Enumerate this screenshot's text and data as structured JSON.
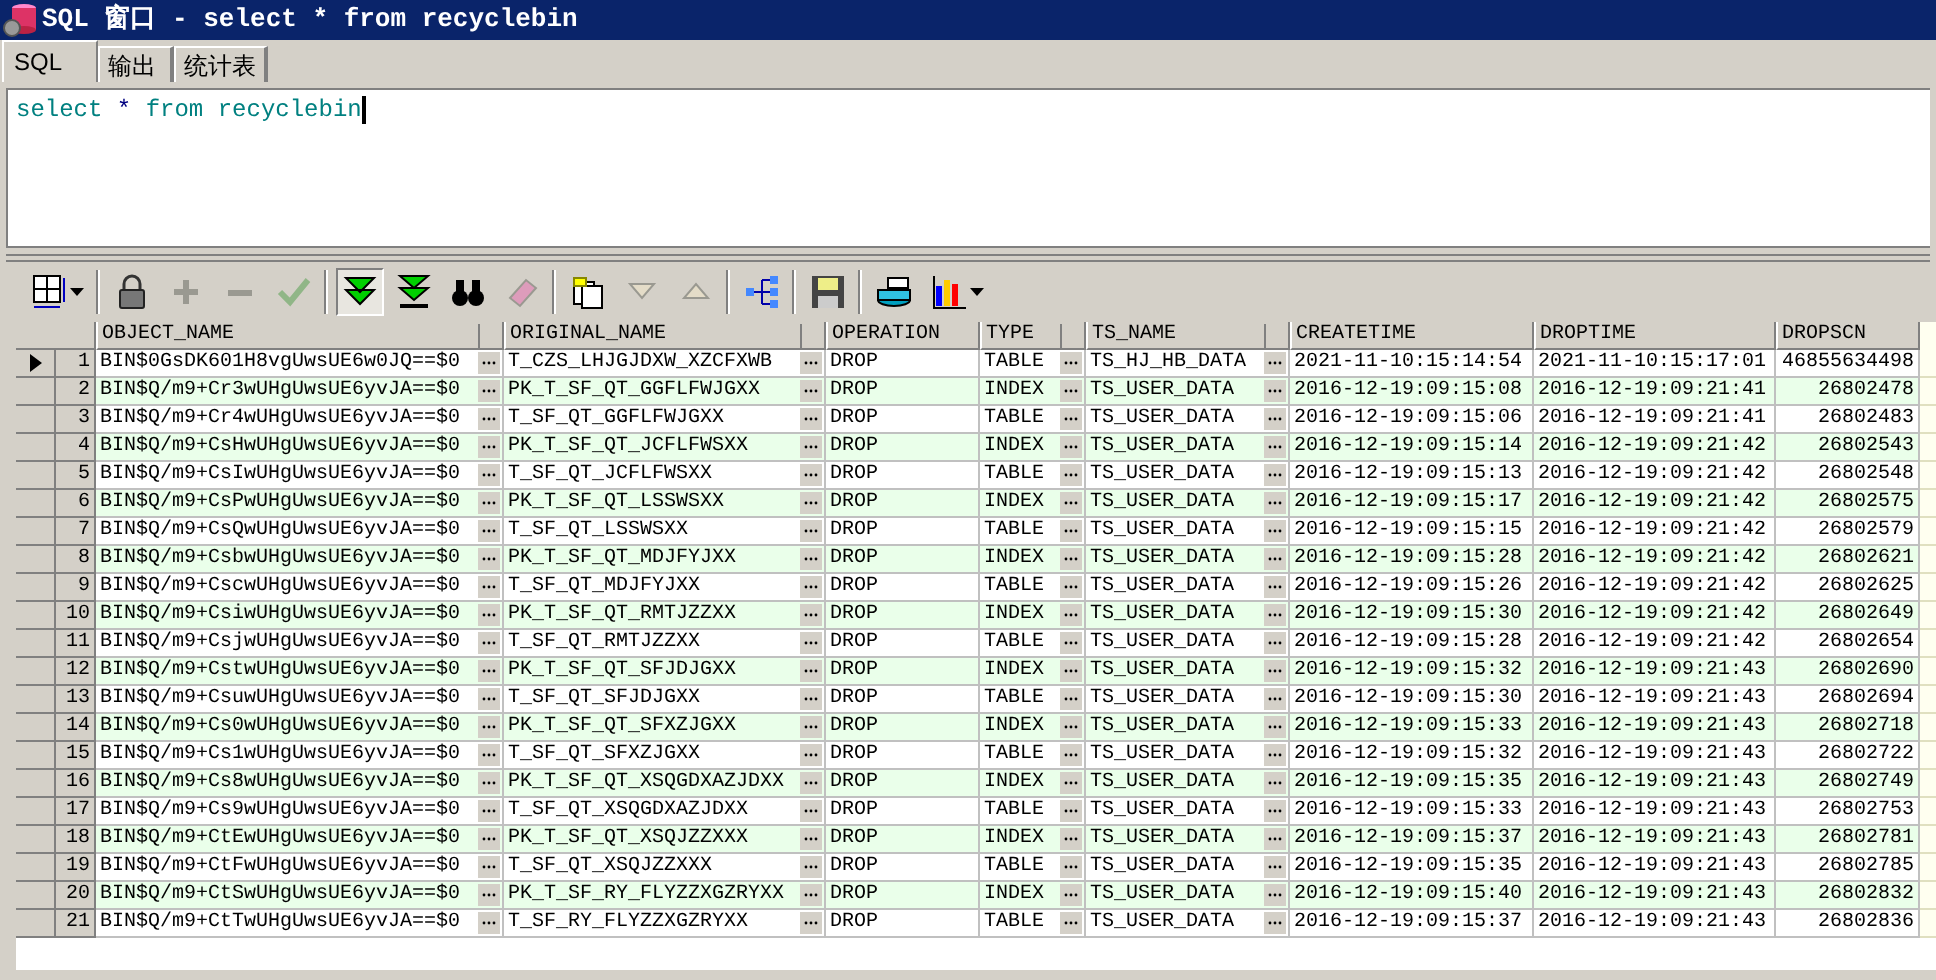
{
  "window": {
    "title": "SQL 窗口 - select * from recyclebin"
  },
  "tabs": [
    {
      "label": "SQL",
      "selected": true
    },
    {
      "label": "输出",
      "selected": false
    },
    {
      "label": "统计表",
      "selected": false
    }
  ],
  "editor": {
    "tokens": [
      {
        "text": "select",
        "kind": "keyword"
      },
      {
        "text": "*",
        "kind": "operator"
      },
      {
        "text": "from",
        "kind": "keyword"
      },
      {
        "text": "recyclebin",
        "kind": "identifier"
      }
    ]
  },
  "toolbar": [
    {
      "kind": "grid",
      "disabled": false,
      "pressed": false,
      "dropdown": true
    },
    {
      "kind": "lock",
      "disabled": false,
      "pressed": false,
      "dropdown": false
    },
    {
      "kind": "plus",
      "disabled": true,
      "pressed": false,
      "dropdown": false
    },
    {
      "kind": "minus",
      "disabled": true,
      "pressed": false,
      "dropdown": false
    },
    {
      "kind": "check",
      "disabled": true,
      "pressed": false,
      "dropdown": false
    },
    {
      "kind": "fetch-next",
      "disabled": false,
      "pressed": true,
      "dropdown": false
    },
    {
      "kind": "fetch-last",
      "disabled": false,
      "pressed": false,
      "dropdown": false
    },
    {
      "kind": "find",
      "disabled": false,
      "pressed": false,
      "dropdown": false
    },
    {
      "kind": "clear",
      "disabled": true,
      "pressed": false,
      "dropdown": false
    },
    {
      "kind": "note",
      "disabled": false,
      "pressed": false,
      "dropdown": false
    },
    {
      "kind": "down",
      "disabled": true,
      "pressed": false,
      "dropdown": false
    },
    {
      "kind": "up",
      "disabled": true,
      "pressed": false,
      "dropdown": false
    },
    {
      "kind": "tree",
      "disabled": false,
      "pressed": false,
      "dropdown": false
    },
    {
      "kind": "save",
      "disabled": false,
      "pressed": false,
      "dropdown": false
    },
    {
      "kind": "print",
      "disabled": false,
      "pressed": false,
      "dropdown": false
    },
    {
      "kind": "chart",
      "disabled": false,
      "pressed": false,
      "dropdown": true
    }
  ],
  "table": {
    "columns": [
      {
        "label": "OBJECT_NAME",
        "ellipsis": true,
        "kind": "text"
      },
      {
        "label": "ORIGINAL_NAME",
        "ellipsis": true,
        "kind": "text"
      },
      {
        "label": "OPERATION",
        "ellipsis": false,
        "kind": "text"
      },
      {
        "label": "TYPE",
        "ellipsis": true,
        "kind": "text"
      },
      {
        "label": "TS_NAME",
        "ellipsis": true,
        "kind": "text"
      },
      {
        "label": "CREATETIME",
        "ellipsis": false,
        "kind": "text"
      },
      {
        "label": "DROPTIME",
        "ellipsis": false,
        "kind": "text"
      },
      {
        "label": "DROPSCN",
        "ellipsis": false,
        "kind": "number"
      }
    ],
    "rows": [
      {
        "number": "1",
        "current": true,
        "cells": [
          "BIN$0GsDK601H8vgUwsUE6w0JQ==$0",
          "T_CZS_LHJGJDXW_XZCFXWB",
          "DROP",
          "TABLE",
          "TS_HJ_HB_DATA",
          "2021-11-10:15:14:54",
          "2021-11-10:15:17:01",
          "46855634498"
        ]
      },
      {
        "number": "2",
        "current": false,
        "cells": [
          "BIN$Q/m9+Cr3wUHgUwsUE6yvJA==$0",
          "PK_T_SF_QT_GGFLFWJGXX",
          "DROP",
          "INDEX",
          "TS_USER_DATA",
          "2016-12-19:09:15:08",
          "2016-12-19:09:21:41",
          "26802478"
        ]
      },
      {
        "number": "3",
        "current": false,
        "cells": [
          "BIN$Q/m9+Cr4wUHgUwsUE6yvJA==$0",
          "T_SF_QT_GGFLFWJGXX",
          "DROP",
          "TABLE",
          "TS_USER_DATA",
          "2016-12-19:09:15:06",
          "2016-12-19:09:21:41",
          "26802483"
        ]
      },
      {
        "number": "4",
        "current": false,
        "cells": [
          "BIN$Q/m9+CsHwUHgUwsUE6yvJA==$0",
          "PK_T_SF_QT_JCFLFWSXX",
          "DROP",
          "INDEX",
          "TS_USER_DATA",
          "2016-12-19:09:15:14",
          "2016-12-19:09:21:42",
          "26802543"
        ]
      },
      {
        "number": "5",
        "current": false,
        "cells": [
          "BIN$Q/m9+CsIwUHgUwsUE6yvJA==$0",
          "T_SF_QT_JCFLFWSXX",
          "DROP",
          "TABLE",
          "TS_USER_DATA",
          "2016-12-19:09:15:13",
          "2016-12-19:09:21:42",
          "26802548"
        ]
      },
      {
        "number": "6",
        "current": false,
        "cells": [
          "BIN$Q/m9+CsPwUHgUwsUE6yvJA==$0",
          "PK_T_SF_QT_LSSWSXX",
          "DROP",
          "INDEX",
          "TS_USER_DATA",
          "2016-12-19:09:15:17",
          "2016-12-19:09:21:42",
          "26802575"
        ]
      },
      {
        "number": "7",
        "current": false,
        "cells": [
          "BIN$Q/m9+CsQwUHgUwsUE6yvJA==$0",
          "T_SF_QT_LSSWSXX",
          "DROP",
          "TABLE",
          "TS_USER_DATA",
          "2016-12-19:09:15:15",
          "2016-12-19:09:21:42",
          "26802579"
        ]
      },
      {
        "number": "8",
        "current": false,
        "cells": [
          "BIN$Q/m9+CsbwUHgUwsUE6yvJA==$0",
          "PK_T_SF_QT_MDJFYJXX",
          "DROP",
          "INDEX",
          "TS_USER_DATA",
          "2016-12-19:09:15:28",
          "2016-12-19:09:21:42",
          "26802621"
        ]
      },
      {
        "number": "9",
        "current": false,
        "cells": [
          "BIN$Q/m9+CscwUHgUwsUE6yvJA==$0",
          "T_SF_QT_MDJFYJXX",
          "DROP",
          "TABLE",
          "TS_USER_DATA",
          "2016-12-19:09:15:26",
          "2016-12-19:09:21:42",
          "26802625"
        ]
      },
      {
        "number": "10",
        "current": false,
        "cells": [
          "BIN$Q/m9+CsiwUHgUwsUE6yvJA==$0",
          "PK_T_SF_QT_RMTJZZXX",
          "DROP",
          "INDEX",
          "TS_USER_DATA",
          "2016-12-19:09:15:30",
          "2016-12-19:09:21:42",
          "26802649"
        ]
      },
      {
        "number": "11",
        "current": false,
        "cells": [
          "BIN$Q/m9+CsjwUHgUwsUE6yvJA==$0",
          "T_SF_QT_RMTJZZXX",
          "DROP",
          "TABLE",
          "TS_USER_DATA",
          "2016-12-19:09:15:28",
          "2016-12-19:09:21:42",
          "26802654"
        ]
      },
      {
        "number": "12",
        "current": false,
        "cells": [
          "BIN$Q/m9+CstwUHgUwsUE6yvJA==$0",
          "PK_T_SF_QT_SFJDJGXX",
          "DROP",
          "INDEX",
          "TS_USER_DATA",
          "2016-12-19:09:15:32",
          "2016-12-19:09:21:43",
          "26802690"
        ]
      },
      {
        "number": "13",
        "current": false,
        "cells": [
          "BIN$Q/m9+CsuwUHgUwsUE6yvJA==$0",
          "T_SF_QT_SFJDJGXX",
          "DROP",
          "TABLE",
          "TS_USER_DATA",
          "2016-12-19:09:15:30",
          "2016-12-19:09:21:43",
          "26802694"
        ]
      },
      {
        "number": "14",
        "current": false,
        "cells": [
          "BIN$Q/m9+Cs0wUHgUwsUE6yvJA==$0",
          "PK_T_SF_QT_SFXZJGXX",
          "DROP",
          "INDEX",
          "TS_USER_DATA",
          "2016-12-19:09:15:33",
          "2016-12-19:09:21:43",
          "26802718"
        ]
      },
      {
        "number": "15",
        "current": false,
        "cells": [
          "BIN$Q/m9+Cs1wUHgUwsUE6yvJA==$0",
          "T_SF_QT_SFXZJGXX",
          "DROP",
          "TABLE",
          "TS_USER_DATA",
          "2016-12-19:09:15:32",
          "2016-12-19:09:21:43",
          "26802722"
        ]
      },
      {
        "number": "16",
        "current": false,
        "cells": [
          "BIN$Q/m9+Cs8wUHgUwsUE6yvJA==$0",
          "PK_T_SF_QT_XSQGDXAZJDXX",
          "DROP",
          "INDEX",
          "TS_USER_DATA",
          "2016-12-19:09:15:35",
          "2016-12-19:09:21:43",
          "26802749"
        ]
      },
      {
        "number": "17",
        "current": false,
        "cells": [
          "BIN$Q/m9+Cs9wUHgUwsUE6yvJA==$0",
          "T_SF_QT_XSQGDXAZJDXX",
          "DROP",
          "TABLE",
          "TS_USER_DATA",
          "2016-12-19:09:15:33",
          "2016-12-19:09:21:43",
          "26802753"
        ]
      },
      {
        "number": "18",
        "current": false,
        "cells": [
          "BIN$Q/m9+CtEwUHgUwsUE6yvJA==$0",
          "PK_T_SF_QT_XSQJZZXXX",
          "DROP",
          "INDEX",
          "TS_USER_DATA",
          "2016-12-19:09:15:37",
          "2016-12-19:09:21:43",
          "26802781"
        ]
      },
      {
        "number": "19",
        "current": false,
        "cells": [
          "BIN$Q/m9+CtFwUHgUwsUE6yvJA==$0",
          "T_SF_QT_XSQJZZXXX",
          "DROP",
          "TABLE",
          "TS_USER_DATA",
          "2016-12-19:09:15:35",
          "2016-12-19:09:21:43",
          "26802785"
        ]
      },
      {
        "number": "20",
        "current": false,
        "cells": [
          "BIN$Q/m9+CtSwUHgUwsUE6yvJA==$0",
          "PK_T_SF_RY_FLYZZXGZRYXX",
          "DROP",
          "INDEX",
          "TS_USER_DATA",
          "2016-12-19:09:15:40",
          "2016-12-19:09:21:43",
          "26802832"
        ]
      },
      {
        "number": "21",
        "current": false,
        "cells": [
          "BIN$Q/m9+CtTwUHgUwsUE6yvJA==$0",
          "T_SF_RY_FLYZZXGZRYXX",
          "DROP",
          "TABLE",
          "TS_USER_DATA",
          "2016-12-19:09:15:37",
          "2016-12-19:09:21:43",
          "26802836"
        ]
      }
    ]
  }
}
